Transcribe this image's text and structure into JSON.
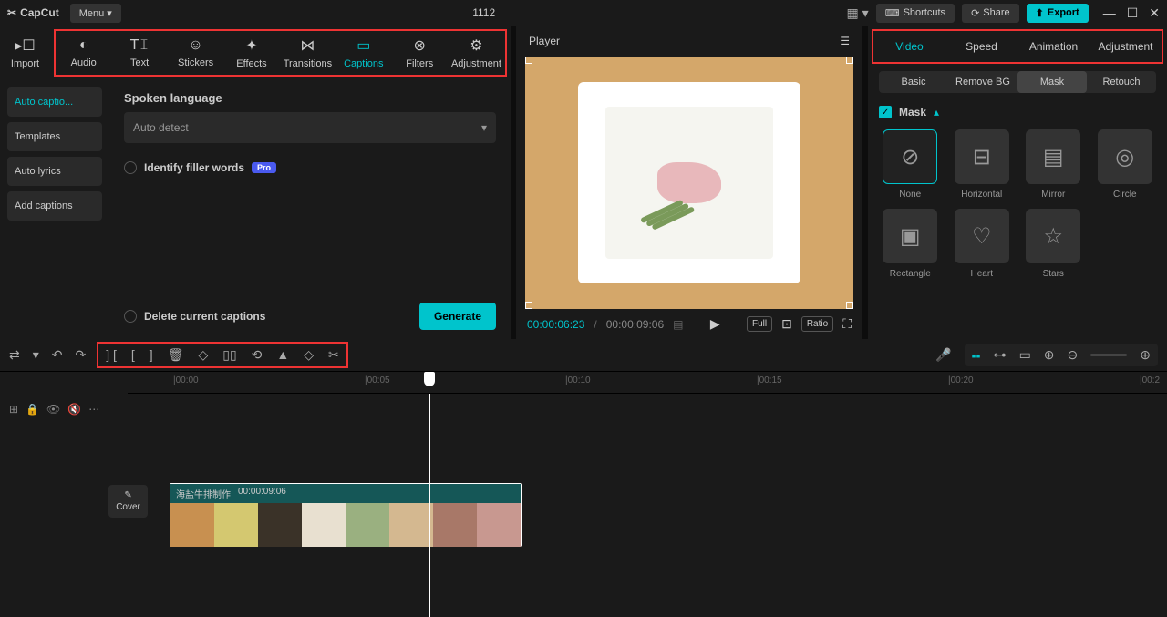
{
  "app": {
    "name": "CapCut",
    "menu": "Menu ▾",
    "project_title": "1112"
  },
  "titlebar": {
    "shortcuts": "Shortcuts",
    "share": "Share",
    "export": "Export"
  },
  "top_tabs": {
    "import": "Import",
    "items": [
      {
        "label": "Audio"
      },
      {
        "label": "Text"
      },
      {
        "label": "Stickers"
      },
      {
        "label": "Effects"
      },
      {
        "label": "Transitions"
      },
      {
        "label": "Captions"
      },
      {
        "label": "Filters"
      },
      {
        "label": "Adjustment"
      }
    ]
  },
  "sidebar": {
    "items": [
      "Auto captio...",
      "Templates",
      "Auto lyrics",
      "Add captions"
    ]
  },
  "captions_panel": {
    "lang_label": "Spoken language",
    "lang_value": "Auto detect",
    "filler_label": "Identify filler words",
    "pro": "Pro",
    "delete_label": "Delete current captions",
    "generate": "Generate"
  },
  "player": {
    "title": "Player",
    "time_current": "00:00:06:23",
    "time_total": "00:00:09:06",
    "full": "Full",
    "ratio": "Ratio"
  },
  "right_tabs": [
    "Video",
    "Speed",
    "Animation",
    "Adjustment"
  ],
  "sub_tabs": [
    "Basic",
    "Remove BG",
    "Mask",
    "Retouch"
  ],
  "mask": {
    "title": "Mask",
    "items": [
      "None",
      "Horizontal",
      "Mirror",
      "Circle",
      "Rectangle",
      "Heart",
      "Stars"
    ]
  },
  "timeline": {
    "cover": "Cover",
    "marks": [
      "|00:00",
      "|00:05",
      "|00:10",
      "|00:15",
      "|00:20",
      "|00:2"
    ],
    "clip_name": "海盐牛排制作",
    "clip_duration": "00:00:09:06"
  }
}
